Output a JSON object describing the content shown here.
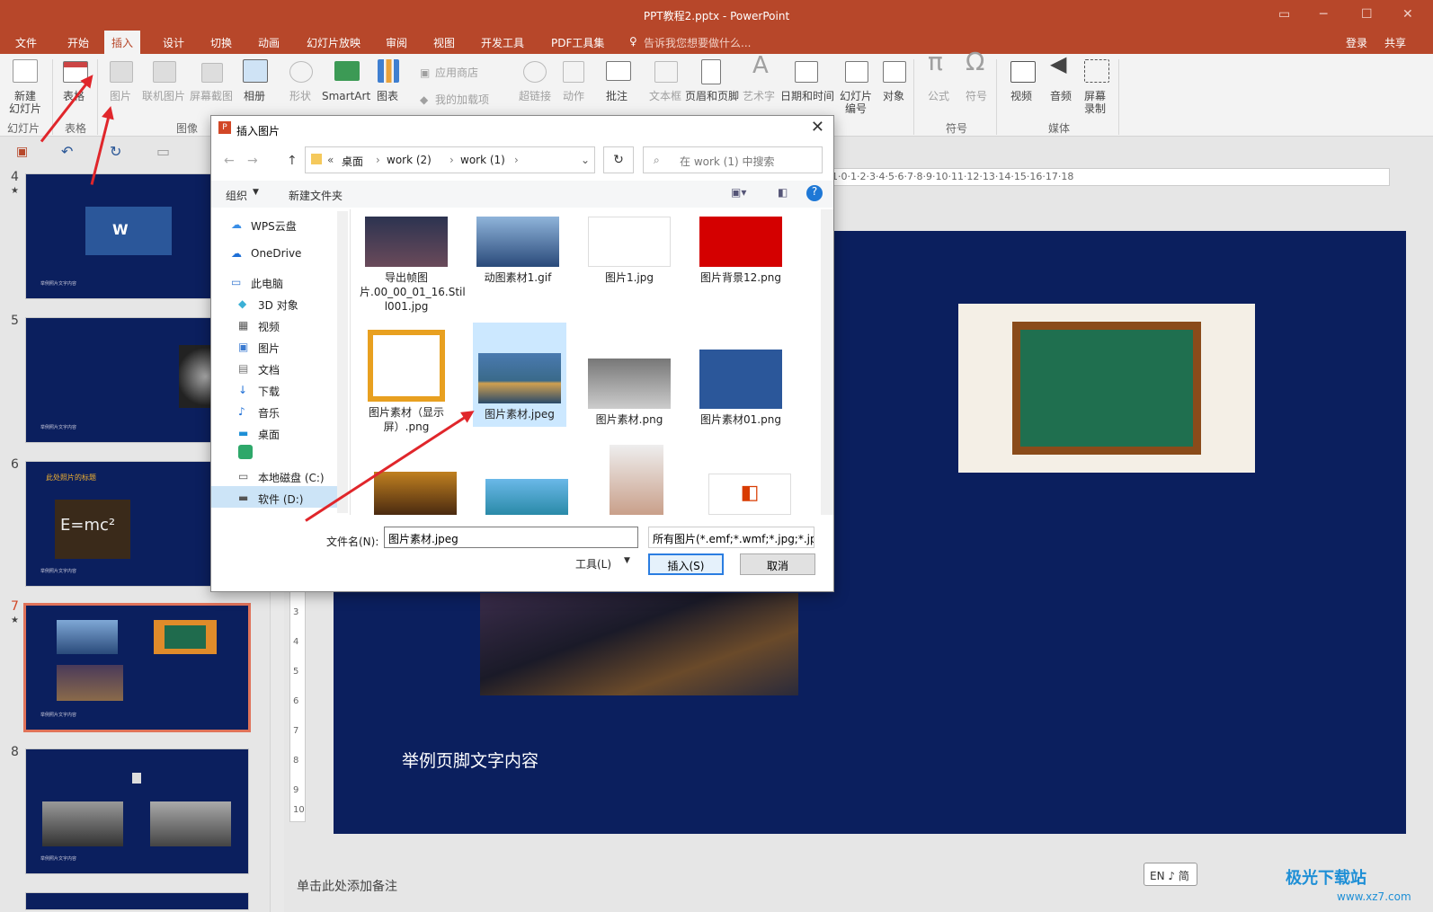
{
  "window": {
    "title": "PPT教程2.pptx - PowerPoint"
  },
  "menu": {
    "tabs": [
      "文件",
      "开始",
      "插入",
      "设计",
      "切换",
      "动画",
      "幻灯片放映",
      "审阅",
      "视图",
      "开发工具",
      "PDF工具集"
    ],
    "tell_me": "告诉我您想要做什么...",
    "login": "登录",
    "share": "共享"
  },
  "ribbon": {
    "new_slide": "新建\n幻灯片",
    "table": "表格",
    "picture": "图片",
    "online_picture": "联机图片",
    "screenshot": "屏幕截图",
    "album": "相册",
    "shapes": "形状",
    "smartart": "SmartArt",
    "chart": "图表",
    "store": "应用商店",
    "my_addins": "我的加载项",
    "hyperlink": "超链接",
    "action": "动作",
    "comment": "批注",
    "textbox": "文本框",
    "header_footer": "页眉和页脚",
    "wordart": "艺术字",
    "datetime": "日期和时间",
    "slide_number": "幻灯片\n编号",
    "object": "对象",
    "equation": "公式",
    "symbol": "符号",
    "video": "视频",
    "audio": "音频",
    "screen_record": "屏幕\n录制",
    "groups": {
      "slides": "幻灯片",
      "tables": "表格",
      "images": "图像",
      "symbols": "符号",
      "media": "媒体"
    }
  },
  "thumbnails": [
    {
      "num": "4",
      "caption": "举例照片文字内容"
    },
    {
      "num": "5",
      "caption": "举例照片文字内容"
    },
    {
      "num": "6",
      "title": "此处照片的标题",
      "formula": "E=mc²",
      "caption": "举例照片文字内容"
    },
    {
      "num": "7",
      "caption": "举例照片文字内容"
    },
    {
      "num": "8",
      "caption": "举例照片文字内容"
    }
  ],
  "ruler_h": "1·0·1·2·3·4·5·6·7·8·9·10·11·12·13·14·15·16·17·18",
  "ruler_v": [
    "3",
    "4",
    "5",
    "6",
    "7",
    "8",
    "9",
    "10"
  ],
  "slide": {
    "footer": "举例页脚文字内容"
  },
  "notes": "单击此处添加备注",
  "ime": "EN ♪ 简",
  "watermark": {
    "brand": "极光下载站",
    "url": "www.xz7.com"
  },
  "dialog": {
    "title": "插入图片",
    "breadcrumb": [
      "桌面",
      "work (2)",
      "work (1)"
    ],
    "search_placeholder": "在 work (1) 中搜索",
    "organize": "组织",
    "new_folder": "新建文件夹",
    "nav": [
      "WPS云盘",
      "OneDrive",
      "此电脑",
      "3D 对象",
      "视频",
      "图片",
      "文档",
      "下载",
      "音乐",
      "桌面",
      "",
      "本地磁盘 (C:)",
      "软件 (D:)"
    ],
    "files": [
      "导出帧图片.00_00_01_16.Stil l001.jpg",
      "动图素材1.gif",
      "图片1.jpg",
      "图片背景12.png",
      "图片素材（显示屏）.png",
      "图片素材.jpeg",
      "图片素材.png",
      "图片素材01.png"
    ],
    "filename_label": "文件名(N):",
    "filename_value": "图片素材.jpeg",
    "filetype": "所有图片(*.emf;*.wmf;*.jpg;*.jp",
    "tools": "工具(L)",
    "insert": "插入(S)",
    "cancel": "取消"
  }
}
